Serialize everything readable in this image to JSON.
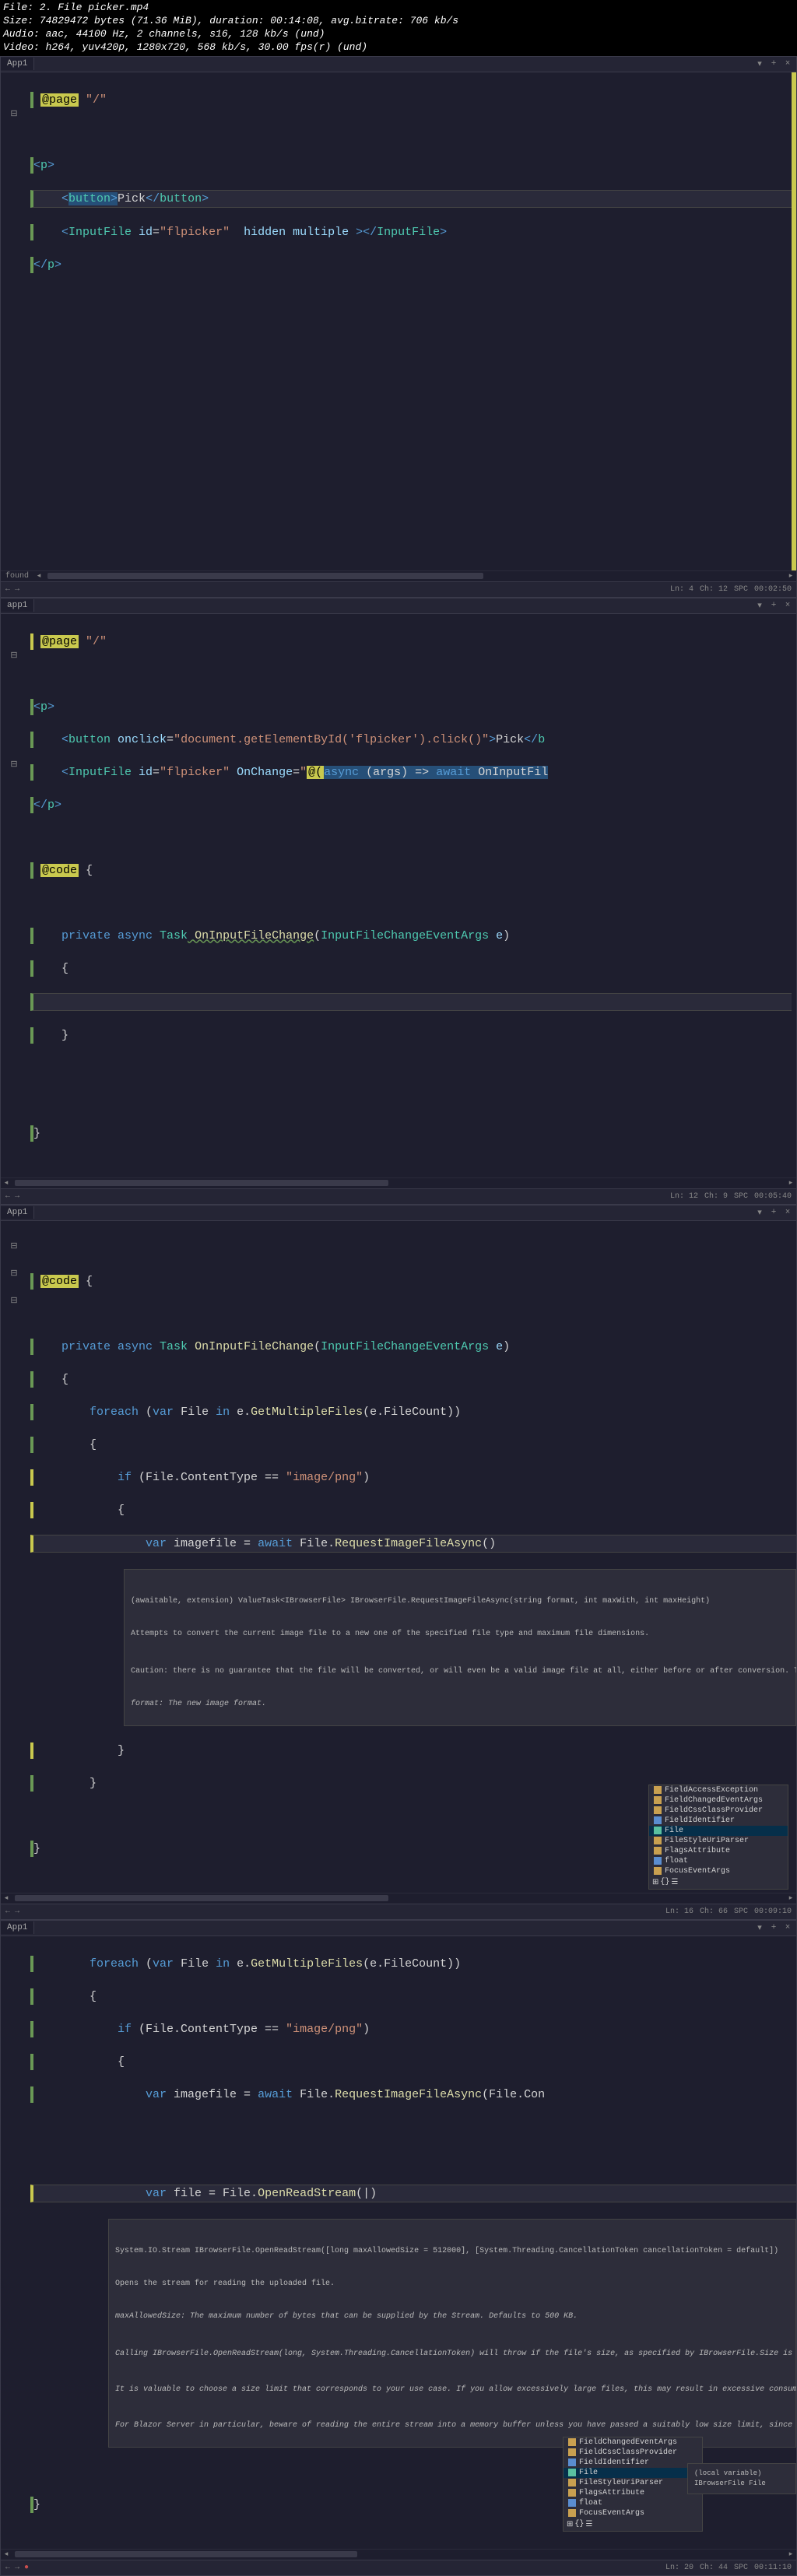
{
  "file_meta": {
    "line1": "File: 2. File picker.mp4",
    "line2": "Size: 74829472 bytes (71.36 MiB), duration: 00:14:08, avg.bitrate: 706 kb/s",
    "line3": "Audio: aac, 44100 Hz, 2 channels, s16, 128 kb/s (und)",
    "line4": "Video: h264, yuv420p, 1280x720, 568 kb/s, 30.00 fps(r) (und)"
  },
  "panel1": {
    "tab": "App1",
    "page_directive": "@page",
    "page_route": "\"/\"",
    "code": {
      "l1a": "<",
      "l1b": "p",
      "l1c": ">",
      "l2a": "    <",
      "l2b": "button",
      "l2c": ">",
      "l2d": "Pick",
      "l2e": "</",
      "l2f": "button",
      "l2g": ">",
      "l3a": "    <",
      "l3b": "InputFile",
      "l3c": " id",
      "l3d": "=",
      "l3e": "\"flpicker\"",
      "l3f": "  hidden multiple ",
      "l3g": "></",
      "l3h": "InputFile",
      "l3i": ">",
      "l4a": "</",
      "l4b": "p",
      "l4c": ">"
    },
    "status": {
      "found": "found",
      "ln": "Ln: 4",
      "ch": "Ch: 12",
      "spc": "SPC",
      "time": "00:02:50"
    }
  },
  "panel2": {
    "tab": "app1",
    "page_directive": "@page",
    "page_route": "\"/\"",
    "code": {
      "l1a": "<",
      "l1b": "p",
      "l1c": ">",
      "l2a": "    <",
      "l2b": "button",
      "l2c": " onclick",
      "l2d": "=",
      "l2e": "\"document.getElementById('flpicker').click()\"",
      "l2f": ">",
      "l2g": "Pick",
      "l2h": "</",
      "l2i": "b",
      "l3a": "    <",
      "l3b": "InputFile",
      "l3c": " id",
      "l3d": "=",
      "l3e": "\"flpicker\"",
      "l3f": " OnChange",
      "l3g": "=",
      "l3h": "\"",
      "l3i": "@(",
      "l3j": "async",
      "l3k": " (args) => ",
      "l3l": "await",
      "l3m": " OnInputFil",
      "l4a": "</",
      "l4b": "p",
      "l4c": ">",
      "l5a": "@code",
      "l5b": " {",
      "l6a": "    private",
      "l6b": " async",
      "l6c": " Task",
      "l6d": " OnInputFileChange",
      "l6e": "(",
      "l6f": "InputFileChangeEventArgs",
      "l6g": " e",
      "l6h": ")",
      "l7": "    {",
      "l8": "    }",
      "l9": "}"
    },
    "status": {
      "ln": "Ln: 12",
      "ch": "Ch: 9",
      "spc": "SPC",
      "time": "00:05:40"
    }
  },
  "panel3": {
    "tab": "App1",
    "code": {
      "l1a": "@code",
      "l1b": " {",
      "l2a": "    private",
      "l2b": " async",
      "l2c": " Task",
      "l2d": " OnInputFileChange",
      "l2e": "(",
      "l2f": "InputFileChangeEventArgs",
      "l2g": " e",
      "l2h": ")",
      "l3": "    {",
      "l4a": "        foreach",
      "l4b": " (",
      "l4c": "var",
      "l4d": " File ",
      "l4e": "in",
      "l4f": " e.",
      "l4g": "GetMultipleFiles",
      "l4h": "(e.FileCount))",
      "l5": "        {",
      "l6a": "            if",
      "l6b": " (File.ContentType == ",
      "l6c": "\"image/png\"",
      "l6d": ")",
      "l7": "            {",
      "l8a": "                var",
      "l8b": " imagefile = ",
      "l8c": "await",
      "l8d": " File.",
      "l8e": "RequestImageFileAsync",
      "l8f": "()",
      "l9": "            }",
      "l10": "        }",
      "l11": "}"
    },
    "tooltip": {
      "sig": "(awaitable, extension) ValueTask<IBrowserFile> IBrowserFile.RequestImageFileAsync(string format, int maxWith, int maxHeight)",
      "desc": "Attempts to convert the current image file to a new one of the specified file type and maximum file dimensions.",
      "caution": "Caution: there is no guarantee that the file will be converted, or will even be a valid image file at all, either before or after conversion. The conversion is requested within the browser b",
      "format": "format: The new image format."
    },
    "intellisense": [
      "FieldAccessException",
      "FieldChangedEventArgs",
      "FieldCssClassProvider",
      "FieldIdentifier",
      "File",
      "FileStyleUriParser",
      "FlagsAttribute",
      "float",
      "FocusEventArgs"
    ],
    "status": {
      "ln": "Ln: 16",
      "ch": "Ch: 66",
      "spc": "SPC",
      "time": "00:09:10"
    }
  },
  "panel4": {
    "tab": "App1",
    "code": {
      "l1a": "        foreach",
      "l1b": " (",
      "l1c": "var",
      "l1d": " File ",
      "l1e": "in",
      "l1f": " e.",
      "l1g": "GetMultipleFiles",
      "l1h": "(e.FileCount))",
      "l2": "        {",
      "l3a": "            if",
      "l3b": " (File.ContentType == ",
      "l3c": "\"image/png\"",
      "l3d": ")",
      "l4": "            {",
      "l5a": "                var",
      "l5b": " imagefile = ",
      "l5c": "await",
      "l5d": " File.",
      "l5e": "RequestImageFileAsync",
      "l5f": "(File.Con",
      "l7a": "                var",
      "l7b": " file = File.",
      "l7c": "OpenReadStream",
      "l7d": "(|)",
      "l8": "}"
    },
    "tooltip": {
      "sig": "System.IO.Stream IBrowserFile.OpenReadStream([long maxAllowedSize = 512000], [System.Threading.CancellationToken cancellationToken = default])",
      "desc": "Opens the stream for reading the uploaded file.",
      "param": "maxAllowedSize: The maximum number of bytes that can be supplied by the Stream. Defaults to 500 KB.",
      "note1": "Calling IBrowserFile.OpenReadStream(long, System.Threading.CancellationToken) will throw if the file's size, as specified by IBrowserFile.Size is larger than maxAllowedSize. By d",
      "note2": "It is valuable to choose a size limit that corresponds to your use case. If you allow excessively large files, this may result in excessive consumption of memory or disk/database space",
      "note3": "For Blazor Server in particular, beware of reading the entire stream into a memory buffer unless you have passed a suitably low size limit, since you will be consuming that memo"
    },
    "intellisense": [
      "FieldChangedEventArgs",
      "FieldCssClassProvider",
      "FieldIdentifier",
      "File",
      "FileStyleUriParser",
      "FlagsAttribute",
      "float",
      "FocusEventArgs"
    ],
    "intellisense_detail": "(local variable) IBrowserFile File",
    "status": {
      "ln": "Ln: 20",
      "ch": "Ch: 44",
      "spc": "SPC",
      "time": "00:11:10"
    }
  }
}
